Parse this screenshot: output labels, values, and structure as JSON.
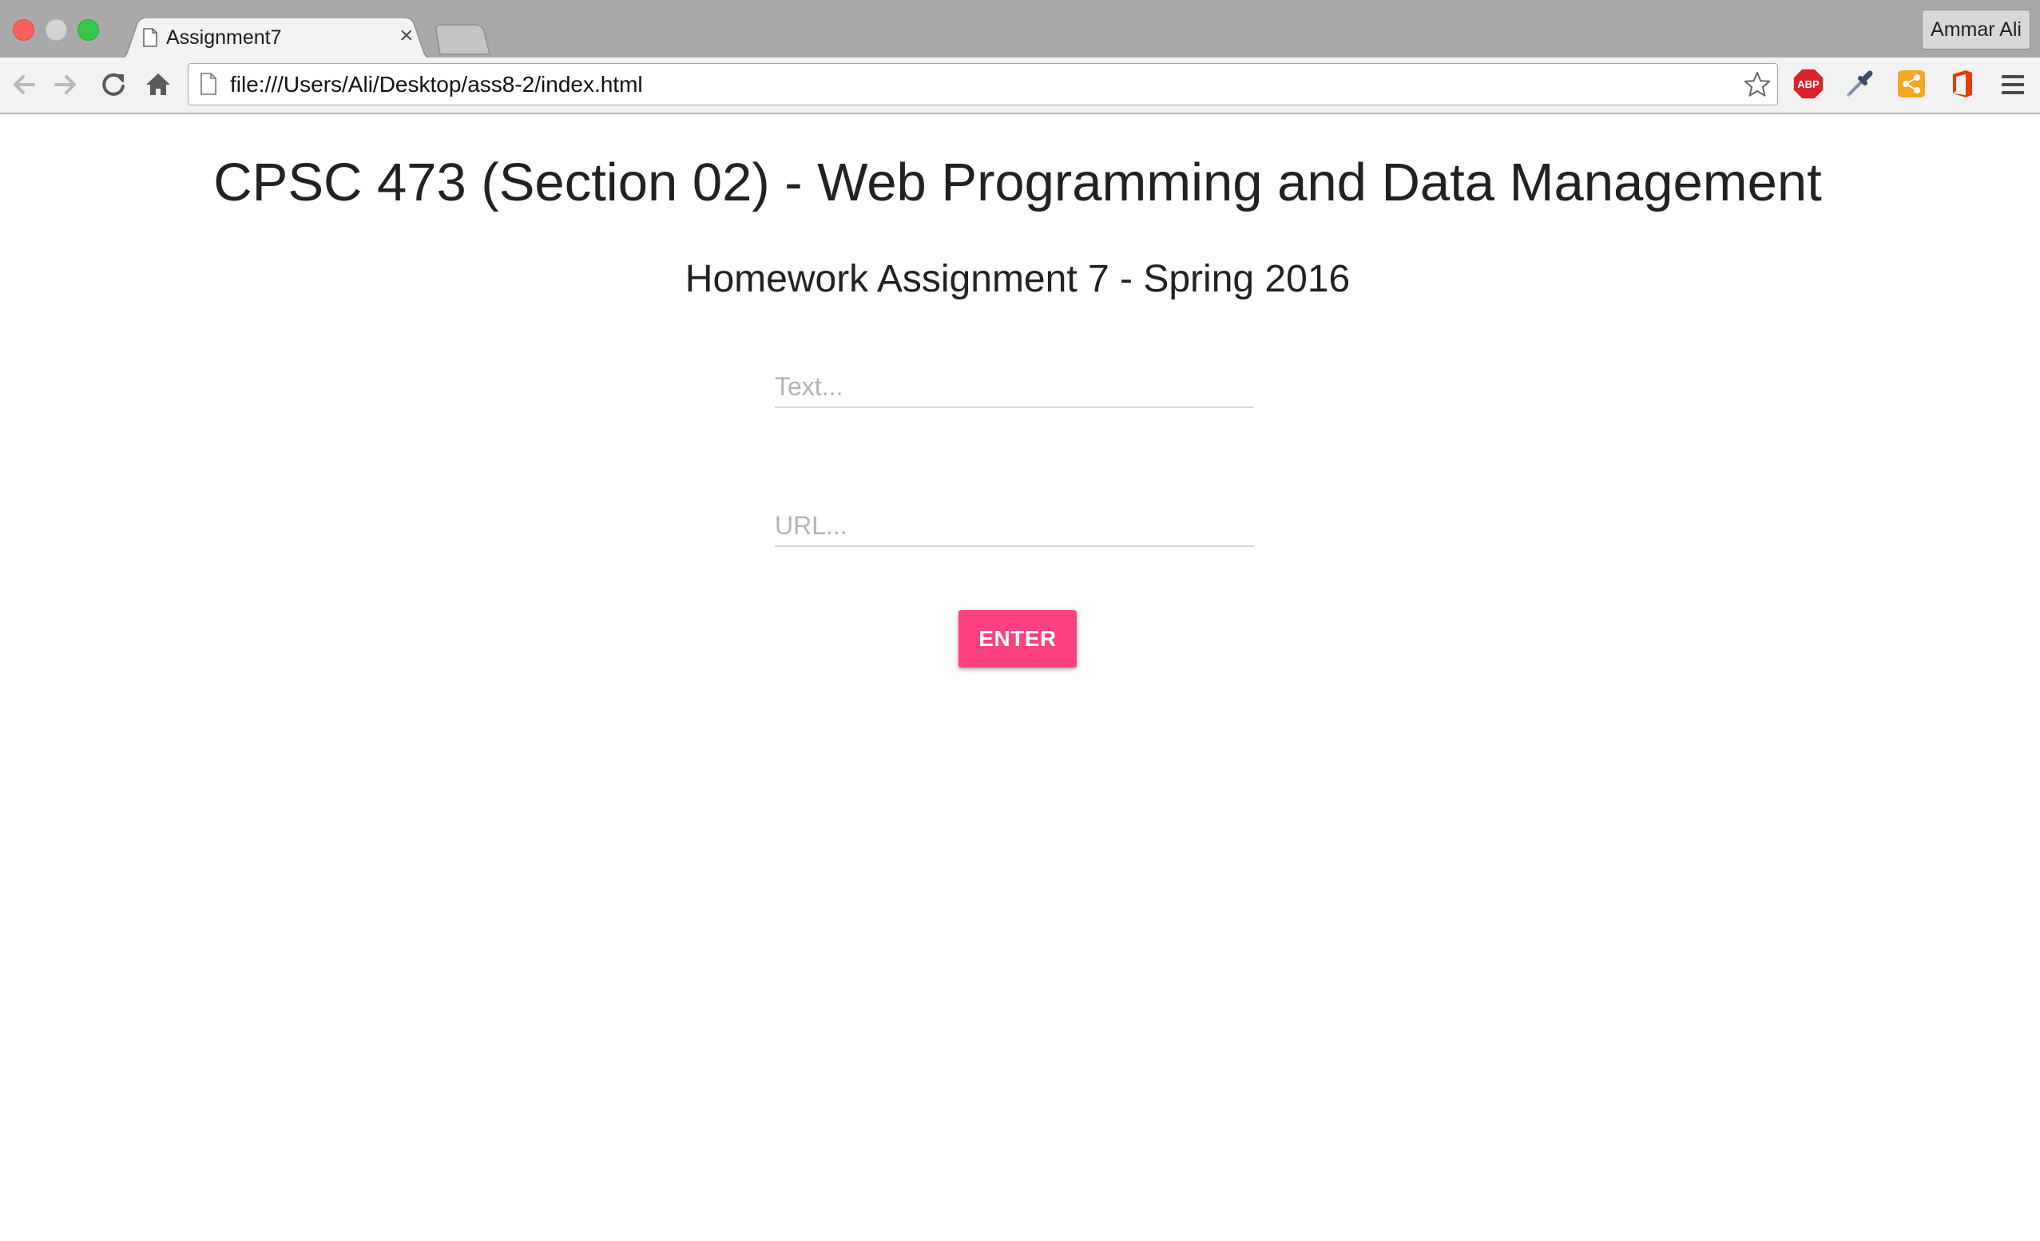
{
  "browser": {
    "tab": {
      "title": "Assignment7",
      "close_glyph": "×"
    },
    "profile_name": "Ammar Ali",
    "address_bar": {
      "url": "file:///Users/Ali/Desktop/ass8-2/index.html"
    },
    "extensions": [
      {
        "name": "adblock-plus-icon",
        "label": "ABP",
        "color": "#d8232a"
      },
      {
        "name": "eyedropper-icon",
        "color": "#5a6b8a"
      },
      {
        "name": "share-extension-icon",
        "color": "#f5a623"
      },
      {
        "name": "office-icon",
        "color": "#eb3c00"
      }
    ]
  },
  "page": {
    "heading": "CPSC 473 (Section 02) - Web Programming and Data Management",
    "subheading": "Homework Assignment 7 - Spring 2016",
    "form": {
      "text_placeholder": "Text...",
      "url_placeholder": "URL...",
      "submit_label": "ENTER"
    }
  },
  "colors": {
    "accent": "#ff4081",
    "tabstrip": "#a9a9a9",
    "toolbar": "#f2f2f2",
    "heading_text": "#212121"
  }
}
